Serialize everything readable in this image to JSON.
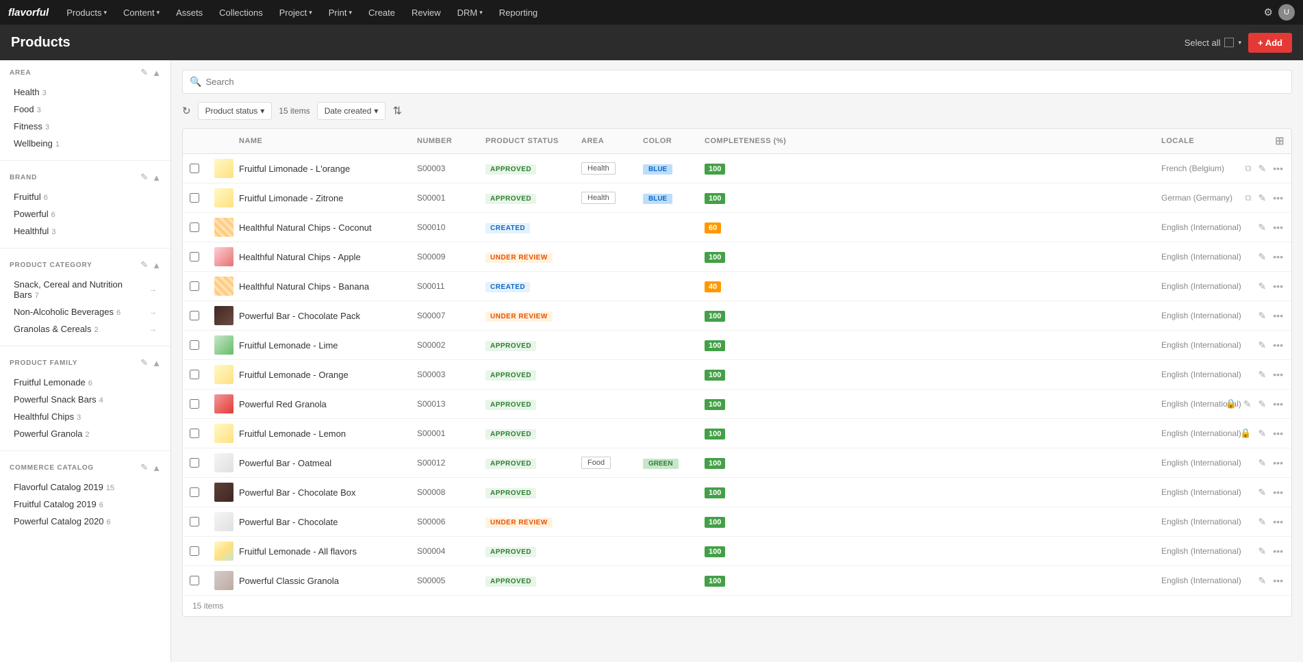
{
  "app": {
    "logo": "flavorful",
    "nav_items": [
      {
        "label": "Products",
        "caret": true
      },
      {
        "label": "Content",
        "caret": true
      },
      {
        "label": "Assets",
        "caret": false
      },
      {
        "label": "Collections",
        "caret": false
      },
      {
        "label": "Project",
        "caret": true
      },
      {
        "label": "Print",
        "caret": true
      },
      {
        "label": "Create",
        "caret": false
      },
      {
        "label": "Review",
        "caret": false
      },
      {
        "label": "DRM",
        "caret": true
      },
      {
        "label": "Reporting",
        "caret": false
      }
    ]
  },
  "page": {
    "title": "Products",
    "select_all_label": "Select all",
    "add_label": "+ Add"
  },
  "sidebar": {
    "area": {
      "title": "AREA",
      "items": [
        {
          "label": "Health",
          "count": "3"
        },
        {
          "label": "Food",
          "count": "3"
        },
        {
          "label": "Fitness",
          "count": "3"
        },
        {
          "label": "Wellbeing",
          "count": "1"
        }
      ]
    },
    "brand": {
      "title": "BRAND",
      "items": [
        {
          "label": "Fruitful",
          "count": "6"
        },
        {
          "label": "Powerful",
          "count": "6"
        },
        {
          "label": "Healthful",
          "count": "3"
        }
      ]
    },
    "product_category": {
      "title": "PRODUCT CATEGORY",
      "items": [
        {
          "label": "Snack, Cereal and Nutrition Bars",
          "count": "7",
          "arrow": true
        },
        {
          "label": "Non-Alcoholic Beverages",
          "count": "6",
          "arrow": true
        },
        {
          "label": "Granolas & Cereals",
          "count": "2",
          "arrow": true
        }
      ]
    },
    "product_family": {
      "title": "PRODUCT FAMILY",
      "items": [
        {
          "label": "Fruitful Lemonade",
          "count": "6"
        },
        {
          "label": "Powerful Snack Bars",
          "count": "4"
        },
        {
          "label": "Healthful Chips",
          "count": "3"
        },
        {
          "label": "Powerful Granola",
          "count": "2"
        }
      ]
    },
    "commerce_catalog": {
      "title": "COMMERCE CATALOG",
      "items": [
        {
          "label": "Flavorful Catalog 2019",
          "count": "15"
        },
        {
          "label": "Fruitful Catalog 2019",
          "count": "6"
        },
        {
          "label": "Powerful Catalog 2020",
          "count": "6"
        }
      ]
    }
  },
  "toolbar": {
    "search_placeholder": "Search",
    "filter_label": "Product status",
    "items_count": "15 items",
    "date_label": "Date created",
    "filter_icon": "▼"
  },
  "table": {
    "columns": [
      "",
      "",
      "Name",
      "Number",
      "Product status",
      "Area",
      "Color",
      "Completeness (%)",
      "Locale",
      ""
    ],
    "rows": [
      {
        "id": 1,
        "name": "Fruitful Limonade - L'orange",
        "number": "S00003",
        "status": "APPROVED",
        "status_type": "approved",
        "area": "Health",
        "color": "BLUE",
        "color_type": "blue",
        "completeness": "100",
        "comp_type": "100",
        "locale": "French (Belgium)",
        "thumb": "thumb-yellow",
        "lock": true,
        "edit": false
      },
      {
        "id": 2,
        "name": "Fruitful Limonade - Zitrone",
        "number": "S00001",
        "status": "APPROVED",
        "status_type": "approved",
        "area": "Health",
        "color": "BLUE",
        "color_type": "blue",
        "completeness": "100",
        "comp_type": "100",
        "locale": "German (Germany)",
        "thumb": "thumb-yellow",
        "lock": true,
        "edit": false
      },
      {
        "id": 3,
        "name": "Healthful Natural Chips - Coconut",
        "number": "S00010",
        "status": "CREATED",
        "status_type": "created",
        "area": "",
        "color": "",
        "color_type": "",
        "completeness": "60",
        "comp_type": "60",
        "locale": "English (International)",
        "thumb": "thumb-orange-stripe",
        "lock": false,
        "edit": false
      },
      {
        "id": 4,
        "name": "Healthful Natural Chips - Apple",
        "number": "S00009",
        "status": "UNDER REVIEW",
        "status_type": "under-review",
        "area": "",
        "color": "",
        "color_type": "",
        "completeness": "100",
        "comp_type": "100",
        "locale": "English (International)",
        "thumb": "thumb-red",
        "lock": false,
        "edit": false
      },
      {
        "id": 5,
        "name": "Healthful Natural Chips - Banana",
        "number": "S00011",
        "status": "CREATED",
        "status_type": "created",
        "area": "",
        "color": "",
        "color_type": "",
        "completeness": "40",
        "comp_type": "40",
        "locale": "English (International)",
        "thumb": "thumb-orange-stripe",
        "lock": false,
        "edit": false
      },
      {
        "id": 6,
        "name": "Powerful Bar - Chocolate Pack",
        "number": "S00007",
        "status": "UNDER REVIEW",
        "status_type": "under-review",
        "area": "",
        "color": "",
        "color_type": "",
        "completeness": "100",
        "comp_type": "100",
        "locale": "English (International)",
        "thumb": "thumb-dark-brown",
        "lock": false,
        "edit": false
      },
      {
        "id": 7,
        "name": "Fruitful Lemonade - Lime",
        "number": "S00002",
        "status": "APPROVED",
        "status_type": "approved",
        "area": "",
        "color": "",
        "color_type": "",
        "completeness": "100",
        "comp_type": "100",
        "locale": "English (International)",
        "thumb": "thumb-green-bottle",
        "lock": false,
        "edit": false
      },
      {
        "id": 8,
        "name": "Fruitful Lemonade - Orange",
        "number": "S00003",
        "status": "APPROVED",
        "status_type": "approved",
        "area": "",
        "color": "",
        "color_type": "",
        "completeness": "100",
        "comp_type": "100",
        "locale": "English (International)",
        "thumb": "thumb-yellow",
        "lock": false,
        "edit": false
      },
      {
        "id": 9,
        "name": "Powerful Red Granola",
        "number": "S00013",
        "status": "APPROVED",
        "status_type": "approved",
        "area": "",
        "color": "",
        "color_type": "",
        "completeness": "100",
        "comp_type": "100",
        "locale": "English (International)",
        "thumb": "thumb-red-granola",
        "lock": true,
        "edit": true
      },
      {
        "id": 10,
        "name": "Fruitful Lemonade - Lemon",
        "number": "S00001",
        "status": "APPROVED",
        "status_type": "approved",
        "area": "",
        "color": "",
        "color_type": "",
        "completeness": "100",
        "comp_type": "100",
        "locale": "English (International)",
        "thumb": "thumb-yellow",
        "lock": true,
        "edit": false
      },
      {
        "id": 11,
        "name": "Powerful Bar - Oatmeal",
        "number": "S00012",
        "status": "APPROVED",
        "status_type": "approved",
        "area": "Food",
        "color": "GREEN",
        "color_type": "green",
        "completeness": "100",
        "comp_type": "100",
        "locale": "English (International)",
        "thumb": "thumb-light",
        "lock": false,
        "edit": false
      },
      {
        "id": 12,
        "name": "Powerful Bar - Chocolate Box",
        "number": "S00008",
        "status": "APPROVED",
        "status_type": "approved",
        "area": "",
        "color": "",
        "color_type": "",
        "completeness": "100",
        "comp_type": "100",
        "locale": "English (International)",
        "thumb": "thumb-choc",
        "lock": false,
        "edit": false
      },
      {
        "id": 13,
        "name": "Powerful Bar - Chocolate",
        "number": "S00006",
        "status": "UNDER REVIEW",
        "status_type": "under-review",
        "area": "",
        "color": "",
        "color_type": "",
        "completeness": "100",
        "comp_type": "100",
        "locale": "English (International)",
        "thumb": "thumb-light",
        "lock": false,
        "edit": false
      },
      {
        "id": 14,
        "name": "Fruitful Lemonade - All flavors",
        "number": "S00004",
        "status": "APPROVED",
        "status_type": "approved",
        "area": "",
        "color": "",
        "color_type": "",
        "completeness": "100",
        "comp_type": "100",
        "locale": "English (International)",
        "thumb": "thumb-multi2",
        "lock": false,
        "edit": false
      },
      {
        "id": 15,
        "name": "Powerful Classic Granola",
        "number": "S00005",
        "status": "APPROVED",
        "status_type": "approved",
        "area": "",
        "color": "",
        "color_type": "",
        "completeness": "100",
        "comp_type": "100",
        "locale": "English (International)",
        "thumb": "thumb-granola-classic",
        "lock": false,
        "edit": false
      }
    ],
    "footer": "15 items"
  }
}
